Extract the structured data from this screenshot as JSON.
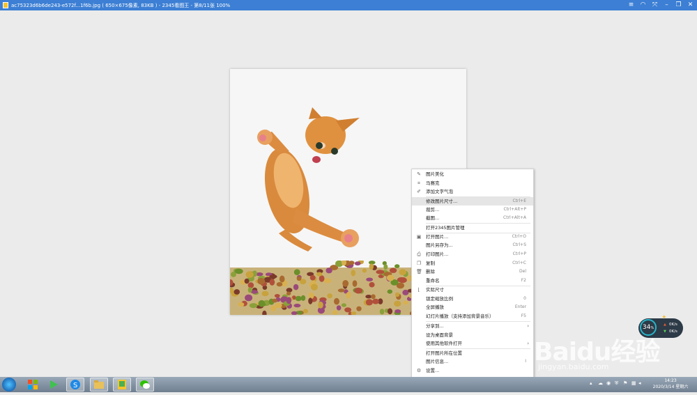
{
  "window": {
    "title": "ac75323d6b6de243-e572f...1f6b.jpg ( 650×675像素, 83KB ) - 2345看图王 - 第8/11张 100%",
    "controls": [
      "≡",
      "◠",
      "⤧",
      "–",
      "❐",
      "✕"
    ]
  },
  "context_menu": {
    "items": [
      {
        "label": "图片美化",
        "shortcut": "",
        "icon": "✎",
        "submenu": false
      },
      {
        "label": "马赛克",
        "shortcut": "",
        "icon": "⌗",
        "submenu": false
      },
      {
        "label": "添加文字气泡",
        "shortcut": "",
        "icon": "✐",
        "submenu": false
      },
      {
        "label": "修改图片尺寸...",
        "shortcut": "Ctrl+E",
        "icon": "",
        "submenu": false
      },
      {
        "label": "裁剪...",
        "shortcut": "Ctrl+Alt+P",
        "icon": "",
        "submenu": false
      },
      {
        "label": "截图...",
        "shortcut": "Ctrl+Alt+A",
        "icon": "",
        "submenu": false
      },
      {
        "label": "打开2345图片管理",
        "shortcut": "",
        "icon": "",
        "submenu": false
      },
      {
        "label": "打开图片...",
        "shortcut": "Ctrl+O",
        "icon": "▣",
        "submenu": false
      },
      {
        "label": "图片另存为...",
        "shortcut": "Ctrl+S",
        "icon": "",
        "submenu": false
      },
      {
        "label": "打印图片...",
        "shortcut": "Ctrl+P",
        "icon": "⎙",
        "submenu": false
      },
      {
        "label": "复制",
        "shortcut": "Ctrl+C",
        "icon": "❐",
        "submenu": false
      },
      {
        "label": "删除",
        "shortcut": "Del",
        "icon": "🗑",
        "submenu": false
      },
      {
        "label": "重命名",
        "shortcut": "F2",
        "icon": "",
        "submenu": false
      },
      {
        "label": "实际尺寸",
        "shortcut": "",
        "icon": "⌊",
        "submenu": false
      },
      {
        "label": "锁定缩放比例",
        "shortcut": "0",
        "icon": "",
        "submenu": false
      },
      {
        "label": "全屏播放",
        "shortcut": "Enter",
        "icon": "",
        "submenu": false
      },
      {
        "label": "幻灯片播放（支持添加背景音乐）",
        "shortcut": "F5",
        "icon": "",
        "submenu": false
      },
      {
        "label": "分享到...",
        "shortcut": "",
        "icon": "",
        "submenu": true
      },
      {
        "label": "设为桌面背景",
        "shortcut": "",
        "icon": "",
        "submenu": false
      },
      {
        "label": "使用其他软件打开",
        "shortcut": "",
        "icon": "",
        "submenu": true
      },
      {
        "label": "打开图片所在位置",
        "shortcut": "",
        "icon": "",
        "submenu": false
      },
      {
        "label": "图片信息...",
        "shortcut": "I",
        "icon": "",
        "submenu": false
      },
      {
        "label": "设置...",
        "shortcut": "",
        "icon": "⚙",
        "submenu": false
      }
    ],
    "highlighted_index": 3
  },
  "net_widget": {
    "percent": "34",
    "percent_unit": "%",
    "upload": "0K/s",
    "download": "0K/s"
  },
  "watermark": {
    "brand": "Baidu经验",
    "url": "jingyan.baidu.com"
  },
  "taskbar": {
    "clock_time": "14:23",
    "clock_date": "2020/3/14 星期六"
  },
  "colors": {
    "titlebar": "#3c7fd4",
    "menu_highlight": "#e5e5e5",
    "widget_ring": "#28b5c9"
  }
}
